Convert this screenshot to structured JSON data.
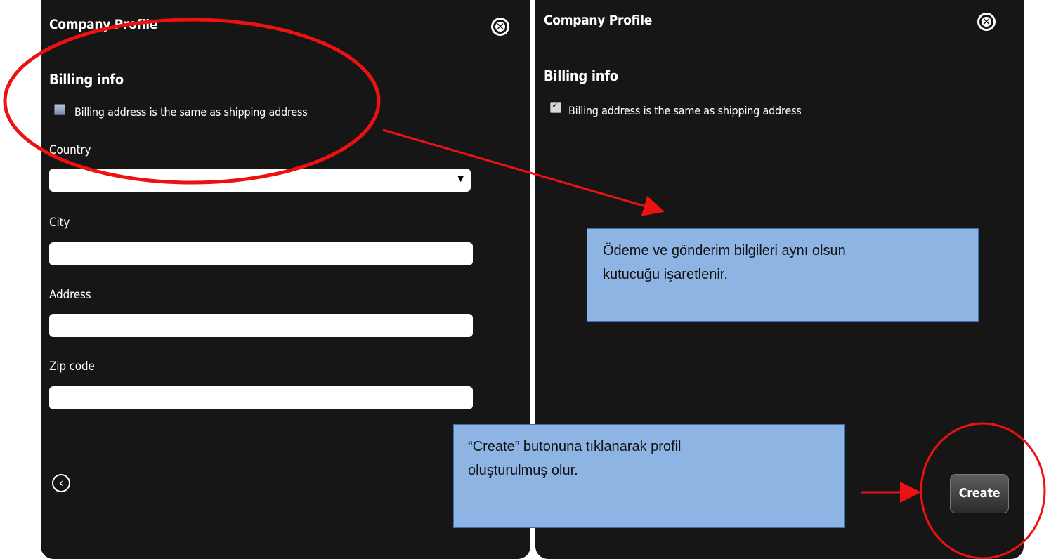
{
  "left_panel": {
    "title": "Company Profile",
    "section": "Billing info",
    "checkbox_label": "Billing address is the same as shipping address",
    "checkbox_checked": false,
    "fields": [
      {
        "label": "Country",
        "type": "select",
        "value": ""
      },
      {
        "label": "City",
        "type": "text",
        "value": ""
      },
      {
        "label": "Address",
        "type": "text",
        "value": ""
      },
      {
        "label": "Zip code",
        "type": "text",
        "value": ""
      }
    ],
    "close_icon": "close-circle-icon",
    "back_icon": "back-circle-icon"
  },
  "right_panel": {
    "title": "Company Profile",
    "section": "Billing info",
    "checkbox_label": "Billing address is the same as shipping address",
    "checkbox_checked": true,
    "create_label": "Create",
    "close_icon": "close-circle-icon"
  },
  "annotations": {
    "callout_checkbox_line1": "Ödeme ve gönderim bilgileri aynı olsun",
    "callout_checkbox_line2": "kutucuğu işaretlenir.",
    "callout_create_line1": "“Create” butonuna tıklanarak profil",
    "callout_create_line2": "oluşturulmuş olur.",
    "highlight_color": "#ee1111",
    "callout_color": "#8eb4e3"
  }
}
